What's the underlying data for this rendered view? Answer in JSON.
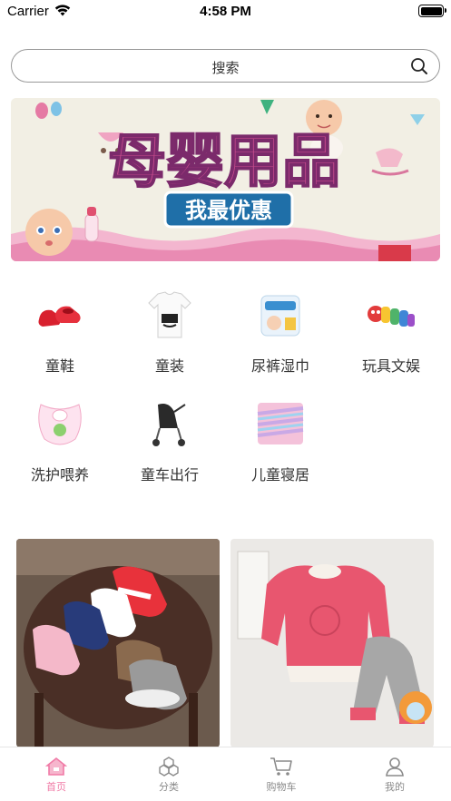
{
  "status_bar": {
    "carrier": "Carrier",
    "time": "4:58 PM",
    "battery_level": 1.0
  },
  "search": {
    "placeholder": "搜索",
    "icon": "search-icon"
  },
  "banner": {
    "headline": "母婴用品",
    "subline": "我最优惠"
  },
  "categories": [
    {
      "label": "童鞋",
      "icon": "baby-shoes-image"
    },
    {
      "label": "童装",
      "icon": "kids-tshirt-image"
    },
    {
      "label": "尿裤湿巾",
      "icon": "diaper-pack-image"
    },
    {
      "label": "玩具文娱",
      "icon": "caterpillar-toy-image"
    },
    {
      "label": "洗护喂养",
      "icon": "bib-image"
    },
    {
      "label": "童车出行",
      "icon": "stroller-image"
    },
    {
      "label": "儿童寝居",
      "icon": "blanket-image"
    }
  ],
  "products": [
    {
      "name": "canvas-kids-shoes"
    },
    {
      "name": "pink-sweater-set"
    }
  ],
  "tabbar": {
    "items": [
      {
        "label": "首页",
        "icon": "home-icon",
        "active": true
      },
      {
        "label": "分类",
        "icon": "category-icon",
        "active": false
      },
      {
        "label": "购物车",
        "icon": "cart-icon",
        "active": false
      },
      {
        "label": "我的",
        "icon": "profile-icon",
        "active": false
      }
    ]
  },
  "colors": {
    "accent": "#f07aa6",
    "inactive": "#8a8a8a"
  }
}
